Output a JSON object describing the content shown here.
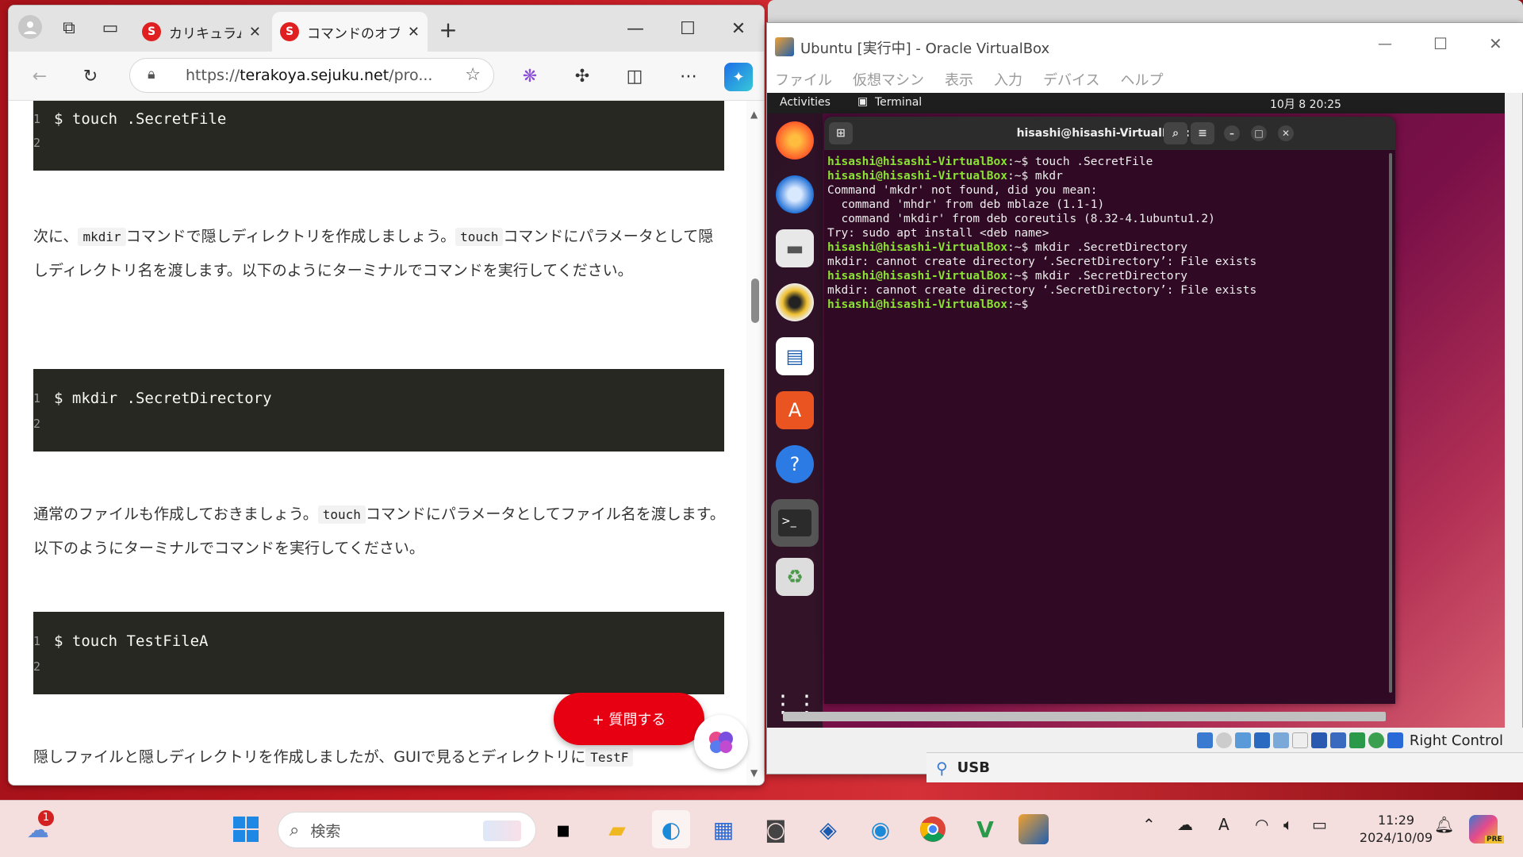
{
  "browser": {
    "tabs": [
      {
        "title": "カリキュラム | プロ"
      },
      {
        "title": "コマンドのオプション"
      }
    ],
    "address_scheme": "https://",
    "address_host": "terakoya.sejuku.net",
    "address_rest": "/pro...",
    "content": {
      "code1": "$ touch .SecretFile",
      "p1_a": "次に、",
      "p1_code1": "mkdir",
      "p1_b": "コマンドで隠しディレクトリを作成しましょう。",
      "p1_code2": "touch",
      "p1_c": "コマンドにパラメータとして隠しディレクトリ名を渡します。以下のようにターミナルでコマンドを実行してください。",
      "code2": "$ mkdir .SecretDirectory",
      "p2_a": "通常のファイルも作成しておきましょう。",
      "p2_code": "touch",
      "p2_b": "コマンドにパラメータとしてファイル名を渡します。以下のようにターミナルでコマンドを実行してください。",
      "code3": "$ touch TestFileA",
      "p3_a": "隠しファイルと隠しディレクトリを作成しましたが、GUIで見るとディレクトリに",
      "p3_code": "TestF",
      "line1": "1",
      "line2": "2",
      "ask_button": "+ 質問する"
    }
  },
  "virtualbox": {
    "title": "Ubuntu [実行中] - Oracle VirtualBox",
    "menu": [
      "ファイル",
      "仮想マシン",
      "表示",
      "入力",
      "デバイス",
      "ヘルプ"
    ],
    "status_key": "Right Control",
    "usb_label": "USB",
    "guest": {
      "activities": "Activities",
      "app_name": "Terminal",
      "datetime": "10月 8  20:25",
      "terminal_title": "hisashi@hisashi-VirtualBox: ~",
      "prompt": "hisashi@hisashi-VirtualBox:~$",
      "lines": [
        {
          "prompt": true,
          "text": " touch .SecretFile"
        },
        {
          "prompt": true,
          "text": " mkdr"
        },
        {
          "prompt": false,
          "text": "Command 'mkdr' not found, did you mean:"
        },
        {
          "prompt": false,
          "text": "  command 'mhdr' from deb mblaze (1.1-1)"
        },
        {
          "prompt": false,
          "text": "  command 'mkdir' from deb coreutils (8.32-4.1ubuntu1.2)"
        },
        {
          "prompt": false,
          "text": "Try: sudo apt install <deb name>"
        },
        {
          "prompt": true,
          "text": " mkdir .SecretDirectory"
        },
        {
          "prompt": false,
          "text": "mkdir: cannot create directory ‘.SecretDirectory’: File exists"
        },
        {
          "prompt": true,
          "text": " mkdir .SecretDirectory"
        },
        {
          "prompt": false,
          "text": "mkdir: cannot create directory ‘.SecretDirectory’: File exists"
        },
        {
          "prompt": true,
          "text": ""
        }
      ]
    }
  },
  "taskbar": {
    "search_placeholder": "検索",
    "notification_badge": "1",
    "time": "11:29",
    "date": "2024/10/09",
    "ime": "A",
    "pre_badge": "PRE"
  },
  "colors": {
    "accent_red": "#e60012",
    "terminal_bg": "#300a24",
    "prompt_green": "#8ae234"
  }
}
